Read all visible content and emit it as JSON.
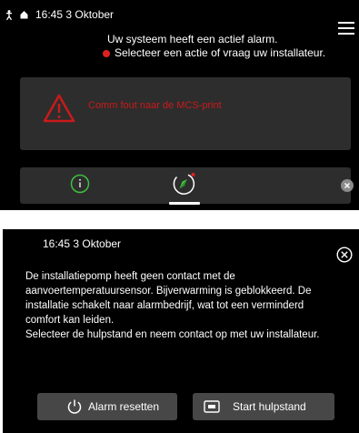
{
  "top_screen": {
    "status": {
      "time_date": "16:45 3 Oktober",
      "icons": [
        "person-icon",
        "home-icon"
      ]
    },
    "alarm_message": {
      "line1": "Uw systeem heeft een actief alarm.",
      "line2": "Selecteer een actie of vraag uw installateur."
    },
    "alarm_card": {
      "text": "Comm fout naar de MCS-print",
      "icon": "warning-icon"
    },
    "tabs": [
      {
        "name": "info",
        "icon": "info-icon"
      },
      {
        "name": "compass",
        "icon": "compass-icon",
        "selected": true
      }
    ],
    "colors": {
      "alarm_red": "#c91a1a",
      "status_dot": "#e02020",
      "compass_green": "#3fbf3f"
    }
  },
  "bottom_screen": {
    "time_date": "16:45 3 Oktober",
    "description": {
      "line1": "De installatiepomp heeft geen contact met de",
      "line2": "aanvoertemperatuursensor. Bijverwarming is geblokkeerd. De",
      "line3": "installatie schakelt naar alarmbedrijf, wat tot een verminderd",
      "line4": "comfort kan leiden.",
      "line5": "Selecteer de hulpstand en neem contact op met uw installateur."
    },
    "buttons": {
      "reset_label": "Alarm resetten",
      "start_label": "Start hulpstand"
    }
  }
}
